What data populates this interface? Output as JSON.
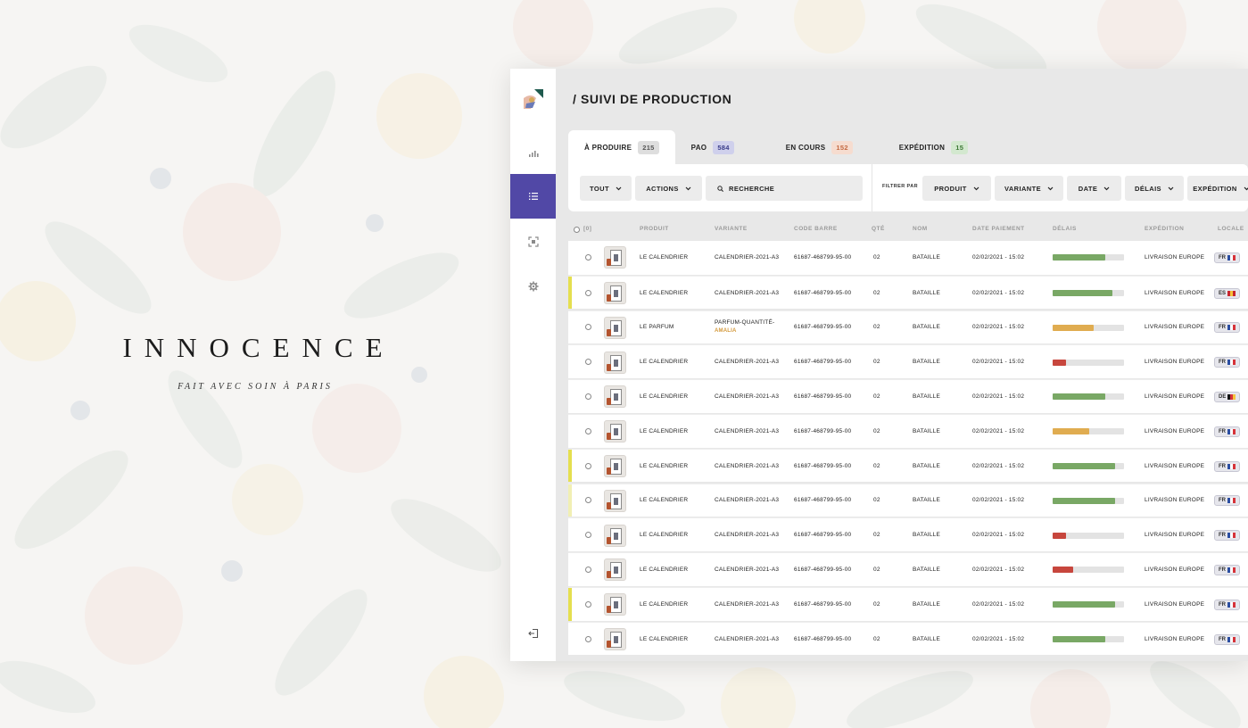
{
  "brand": {
    "title": "INNOCENCE",
    "subtitle": "FAIT AVEC SOIN À PARIS"
  },
  "page": {
    "title": "/ SUIVI DE PRODUCTION"
  },
  "sidebar": {
    "items": [
      {
        "name": "stats",
        "icon": "bar-chart-icon"
      },
      {
        "name": "list",
        "icon": "list-icon",
        "active": true
      },
      {
        "name": "scan",
        "icon": "scan-icon"
      },
      {
        "name": "settings",
        "icon": "gear-icon"
      }
    ],
    "logout_icon": "logout-icon"
  },
  "tabs": [
    {
      "label": "À PRODUIRE",
      "count": "215",
      "color": "gray",
      "active": true
    },
    {
      "label": "PAO",
      "count": "584",
      "color": "blue"
    },
    {
      "label": "EN COURS",
      "count": "152",
      "color": "peach"
    },
    {
      "label": "EXPÉDITION",
      "count": "15",
      "color": "green"
    }
  ],
  "toolbar": {
    "tout": "TOUT",
    "actions": "ACTIONS",
    "search_placeholder": "RECHERCHE",
    "filter_label": "FILTRER PAR",
    "filters": [
      "PRODUIT",
      "VARIANTE",
      "DATE",
      "DÉLAIS",
      "EXPÉDITION"
    ]
  },
  "table": {
    "select_all": "[0]",
    "headers": {
      "produit": "PRODUIT",
      "variante": "VARIANTE",
      "code": "CODE BARRE",
      "qte": "QTÉ",
      "nom": "NOM",
      "date": "DATE PAIEMENT",
      "delais": "DÉLAIS",
      "expedition": "EXPÉDITION",
      "locale": "LOCALE"
    },
    "rows": [
      {
        "produit": "LE CALENDRIER",
        "variante": "CALENDRIER-2021-A3",
        "code": "61687-468799-95-00",
        "qte": "02",
        "nom": "BATAILLE",
        "date": "02/02/2021 - 15:02",
        "delais": 0.74,
        "delais_color": "#79a865",
        "expedition": "LIVRAISON EUROPE",
        "locale": "FR",
        "flag": "fr",
        "mark": ""
      },
      {
        "produit": "LE CALENDRIER",
        "variante": "CALENDRIER-2021-A3",
        "code": "61687-468799-95-00",
        "qte": "02",
        "nom": "BATAILLE",
        "date": "02/02/2021 - 15:02",
        "delais": 0.84,
        "delais_color": "#79a865",
        "expedition": "LIVRAISON EUROPE",
        "locale": "ES",
        "flag": "es",
        "mark": "#e5df4f"
      },
      {
        "produit": "LE PARFUM",
        "variante": "PARFUM-QUANTITÉ-",
        "variante_extra": "AMALIA",
        "code": "61687-468799-95-00",
        "qte": "02",
        "nom": "BATAILLE",
        "date": "02/02/2021 - 15:02",
        "delais": 0.58,
        "delais_color": "#e0ac50",
        "expedition": "LIVRAISON EUROPE",
        "locale": "FR",
        "flag": "fr",
        "mark": ""
      },
      {
        "produit": "LE CALENDRIER",
        "variante": "CALENDRIER-2021-A3",
        "code": "61687-468799-95-00",
        "qte": "02",
        "nom": "BATAILLE",
        "date": "02/02/2021 - 15:02",
        "delais": 0.19,
        "delais_color": "#c7463d",
        "expedition": "LIVRAISON EUROPE",
        "locale": "FR",
        "flag": "fr",
        "mark": ""
      },
      {
        "produit": "LE CALENDRIER",
        "variante": "CALENDRIER-2021-A3",
        "code": "61687-468799-95-00",
        "qte": "02",
        "nom": "BATAILLE",
        "date": "02/02/2021 - 15:02",
        "delais": 0.74,
        "delais_color": "#79a865",
        "expedition": "LIVRAISON EUROPE",
        "locale": "DE",
        "flag": "de",
        "mark": ""
      },
      {
        "produit": "LE CALENDRIER",
        "variante": "CALENDRIER-2021-A3",
        "code": "61687-468799-95-00",
        "qte": "02",
        "nom": "BATAILLE",
        "date": "02/02/2021 - 15:02",
        "delais": 0.51,
        "delais_color": "#e0ac50",
        "expedition": "LIVRAISON EUROPE",
        "locale": "FR",
        "flag": "fr",
        "mark": ""
      },
      {
        "produit": "LE CALENDRIER",
        "variante": "CALENDRIER-2021-A3",
        "code": "61687-468799-95-00",
        "qte": "02",
        "nom": "BATAILLE",
        "date": "02/02/2021 - 15:02",
        "delais": 0.88,
        "delais_color": "#79a865",
        "expedition": "LIVRAISON EUROPE",
        "locale": "FR",
        "flag": "fr",
        "mark": "#e5df4f"
      },
      {
        "produit": "LE CALENDRIER",
        "variante": "CALENDRIER-2021-A3",
        "code": "61687-468799-95-00",
        "qte": "02",
        "nom": "BATAILLE",
        "date": "02/02/2021 - 15:02",
        "delais": 0.88,
        "delais_color": "#79a865",
        "expedition": "LIVRAISON EUROPE",
        "locale": "FR",
        "flag": "fr",
        "mark": "#f1efb3"
      },
      {
        "produit": "LE CALENDRIER",
        "variante": "CALENDRIER-2021-A3",
        "code": "61687-468799-95-00",
        "qte": "02",
        "nom": "BATAILLE",
        "date": "02/02/2021 - 15:02",
        "delais": 0.19,
        "delais_color": "#c7463d",
        "expedition": "LIVRAISON EUROPE",
        "locale": "FR",
        "flag": "fr",
        "mark": ""
      },
      {
        "produit": "LE CALENDRIER",
        "variante": "CALENDRIER-2021-A3",
        "code": "61687-468799-95-00",
        "qte": "02",
        "nom": "BATAILLE",
        "date": "02/02/2021 - 15:02",
        "delais": 0.29,
        "delais_color": "#c7463d",
        "expedition": "LIVRAISON EUROPE",
        "locale": "FR",
        "flag": "fr",
        "mark": ""
      },
      {
        "produit": "LE CALENDRIER",
        "variante": "CALENDRIER-2021-A3",
        "code": "61687-468799-95-00",
        "qte": "02",
        "nom": "BATAILLE",
        "date": "02/02/2021 - 15:02",
        "delais": 0.88,
        "delais_color": "#79a865",
        "expedition": "LIVRAISON EUROPE",
        "locale": "FR",
        "flag": "fr",
        "mark": "#e5df4f"
      },
      {
        "produit": "LE CALENDRIER",
        "variante": "CALENDRIER-2021-A3",
        "code": "61687-468799-95-00",
        "qte": "02",
        "nom": "BATAILLE",
        "date": "02/02/2021 - 15:02",
        "delais": 0.74,
        "delais_color": "#79a865",
        "expedition": "LIVRAISON EUROPE",
        "locale": "FR",
        "flag": "fr",
        "mark": ""
      }
    ]
  },
  "colors": {
    "accent": "#5148a6",
    "green": "#79a865",
    "orange": "#e0ac50",
    "red": "#c7463d",
    "mark_yellow": "#e5df4f"
  }
}
